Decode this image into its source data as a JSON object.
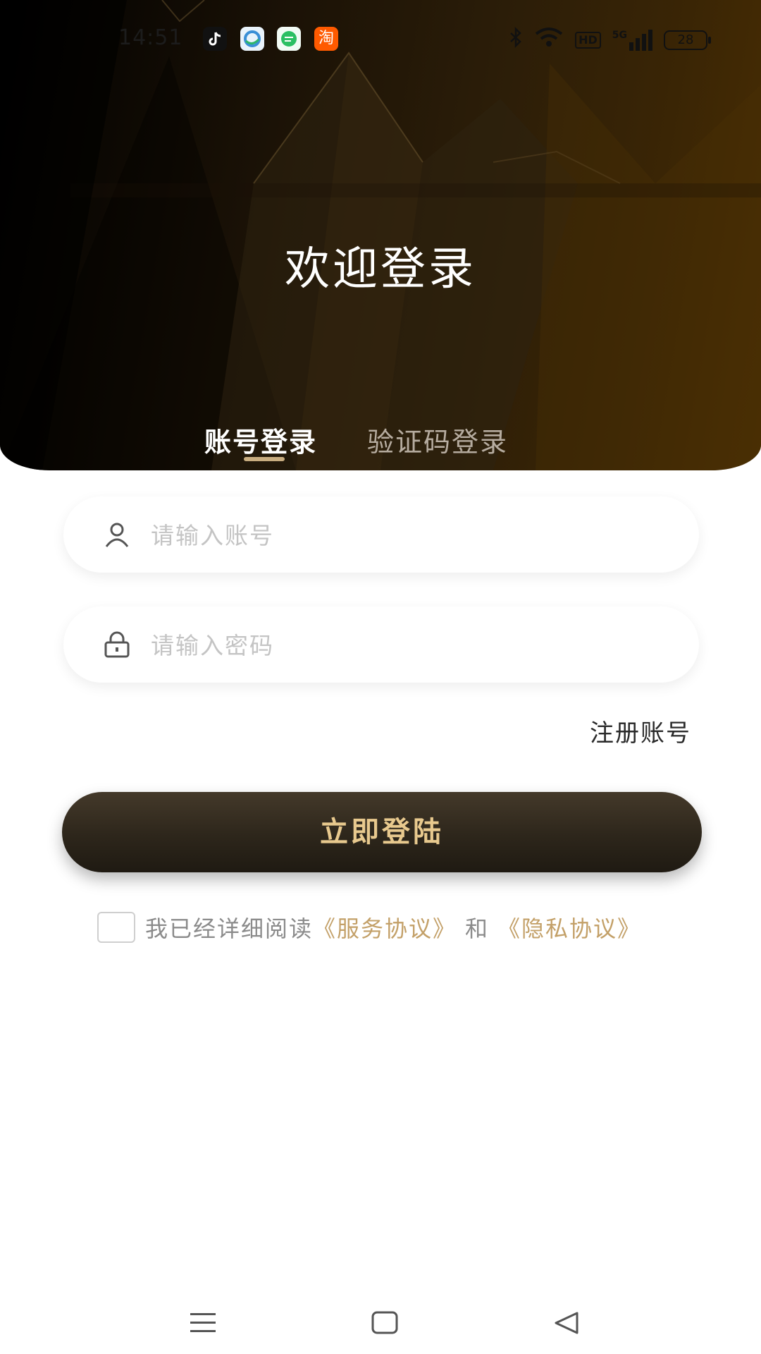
{
  "status_bar": {
    "time": "14:51",
    "apps": [
      {
        "name": "tiktok-icon",
        "color": "#111111"
      },
      {
        "name": "browser-icon",
        "color": "#4aa3e8"
      },
      {
        "name": "message-icon",
        "color": "#2bbf63"
      },
      {
        "name": "taobao-icon",
        "color": "#ff5a00",
        "glyph": "淘"
      }
    ],
    "network": "5G",
    "hd_badge": "HD",
    "battery": "28"
  },
  "header": {
    "title": "欢迎登录",
    "tabs": [
      {
        "label": "账号登录",
        "active": true
      },
      {
        "label": "验证码登录",
        "active": false
      }
    ],
    "accent_color": "#c8ad80"
  },
  "form": {
    "account_placeholder": "请输入账号",
    "password_placeholder": "请输入密码",
    "register_link": "注册账号",
    "login_button": "立即登陆"
  },
  "agreement": {
    "prefix": "我已经详细阅读",
    "service_link": "《服务协议》",
    "conjunction": "和",
    "privacy_link": "《隐私协议》",
    "checked": false
  },
  "nav_bar": {
    "items": [
      "menu-icon",
      "home-icon",
      "back-icon"
    ]
  }
}
